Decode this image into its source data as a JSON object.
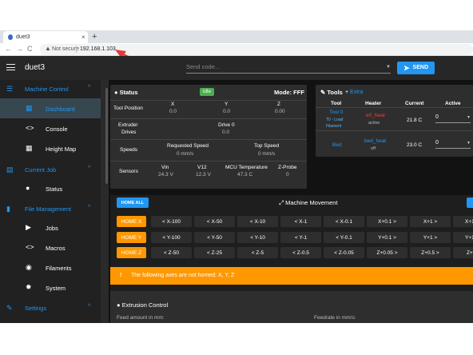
{
  "browser": {
    "tab_title": "duet3",
    "tab_close": "×",
    "new_tab": "+",
    "back": "←",
    "forward": "→",
    "reload": "C",
    "security_icon": "warning-triangle",
    "not_secure": "Not secure",
    "url": "192.168.1.103"
  },
  "app": {
    "title": "duet3",
    "code_placeholder": "Send code...",
    "send_label": "SEND"
  },
  "sidebar": {
    "machine_control": "Machine Control",
    "dashboard": "Dashboard",
    "console": "Console",
    "height_map": "Height Map",
    "current_job": "Current Job",
    "status": "Status",
    "file_management": "File Management",
    "jobs": "Jobs",
    "macros": "Macros",
    "filaments": "Filaments",
    "system": "System",
    "settings": "Settings"
  },
  "status_panel": {
    "title": "Status",
    "state": "idle",
    "mode": "Mode: FFF",
    "tool_position_label": "Tool Position",
    "axes": [
      {
        "name": "X",
        "value": "0.0"
      },
      {
        "name": "Y",
        "value": "0.0"
      },
      {
        "name": "Z",
        "value": "0.00"
      }
    ],
    "extruder_label": "Extruder",
    "drives_label": "Drives",
    "drive0_label": "Drive 0",
    "drive0_value": "0.0",
    "speeds_label": "Speeds",
    "requested_speed_label": "Requested Speed",
    "requested_speed_value": "0 mm/s",
    "top_speed_label": "Top Speed",
    "top_speed_value": "0 mm/s",
    "sensors_label": "Sensors",
    "sensors": [
      {
        "name": "Vin",
        "value": "24.3 V"
      },
      {
        "name": "V12",
        "value": "12.3 V"
      },
      {
        "name": "MCU Temperature",
        "value": "47.3 C"
      },
      {
        "name": "Z-Probe",
        "value": "0"
      }
    ]
  },
  "tools_panel": {
    "title": "Tools",
    "extra": "Extra",
    "headers": [
      "Tool",
      "Heater",
      "Current",
      "Active"
    ],
    "rows": [
      {
        "tool": "Tool 0",
        "tool_sub": "T0 - Load Filament",
        "heater": "e0_heat",
        "heater_state": "active",
        "current": "21.8 C",
        "active": "0"
      },
      {
        "tool": "Bed",
        "tool_sub": "",
        "heater": "bed_heat",
        "heater_state": "off",
        "current": "23.0 C",
        "active": "0"
      }
    ]
  },
  "movement": {
    "home_all": "HOME ALL",
    "title": "Machine Movement",
    "home_x": "HOME X",
    "home_y": "HOME Y",
    "home_z": "HOME Z",
    "x_moves": [
      "X-100",
      "X-50",
      "X-10",
      "X-1",
      "X-0.1",
      "X+0.1",
      "X+1",
      "X+10"
    ],
    "y_moves": [
      "Y-100",
      "Y-50",
      "Y-10",
      "Y-1",
      "Y-0.1",
      "Y+0.1",
      "Y+1",
      "Y+10"
    ],
    "z_moves": [
      "Z-50",
      "Z-25",
      "Z-5",
      "Z-0.5",
      "Z-0.05",
      "Z+0.05",
      "Z+0.5",
      "Z+5"
    ]
  },
  "warning": {
    "icon": "!",
    "text": "The following axes are not homed: X, Y, Z"
  },
  "extrusion": {
    "title": "Extrusion Control",
    "feed_amount_label": "Feed amount in mm:",
    "feedrate_label": "Feedrate in mm/s:"
  }
}
